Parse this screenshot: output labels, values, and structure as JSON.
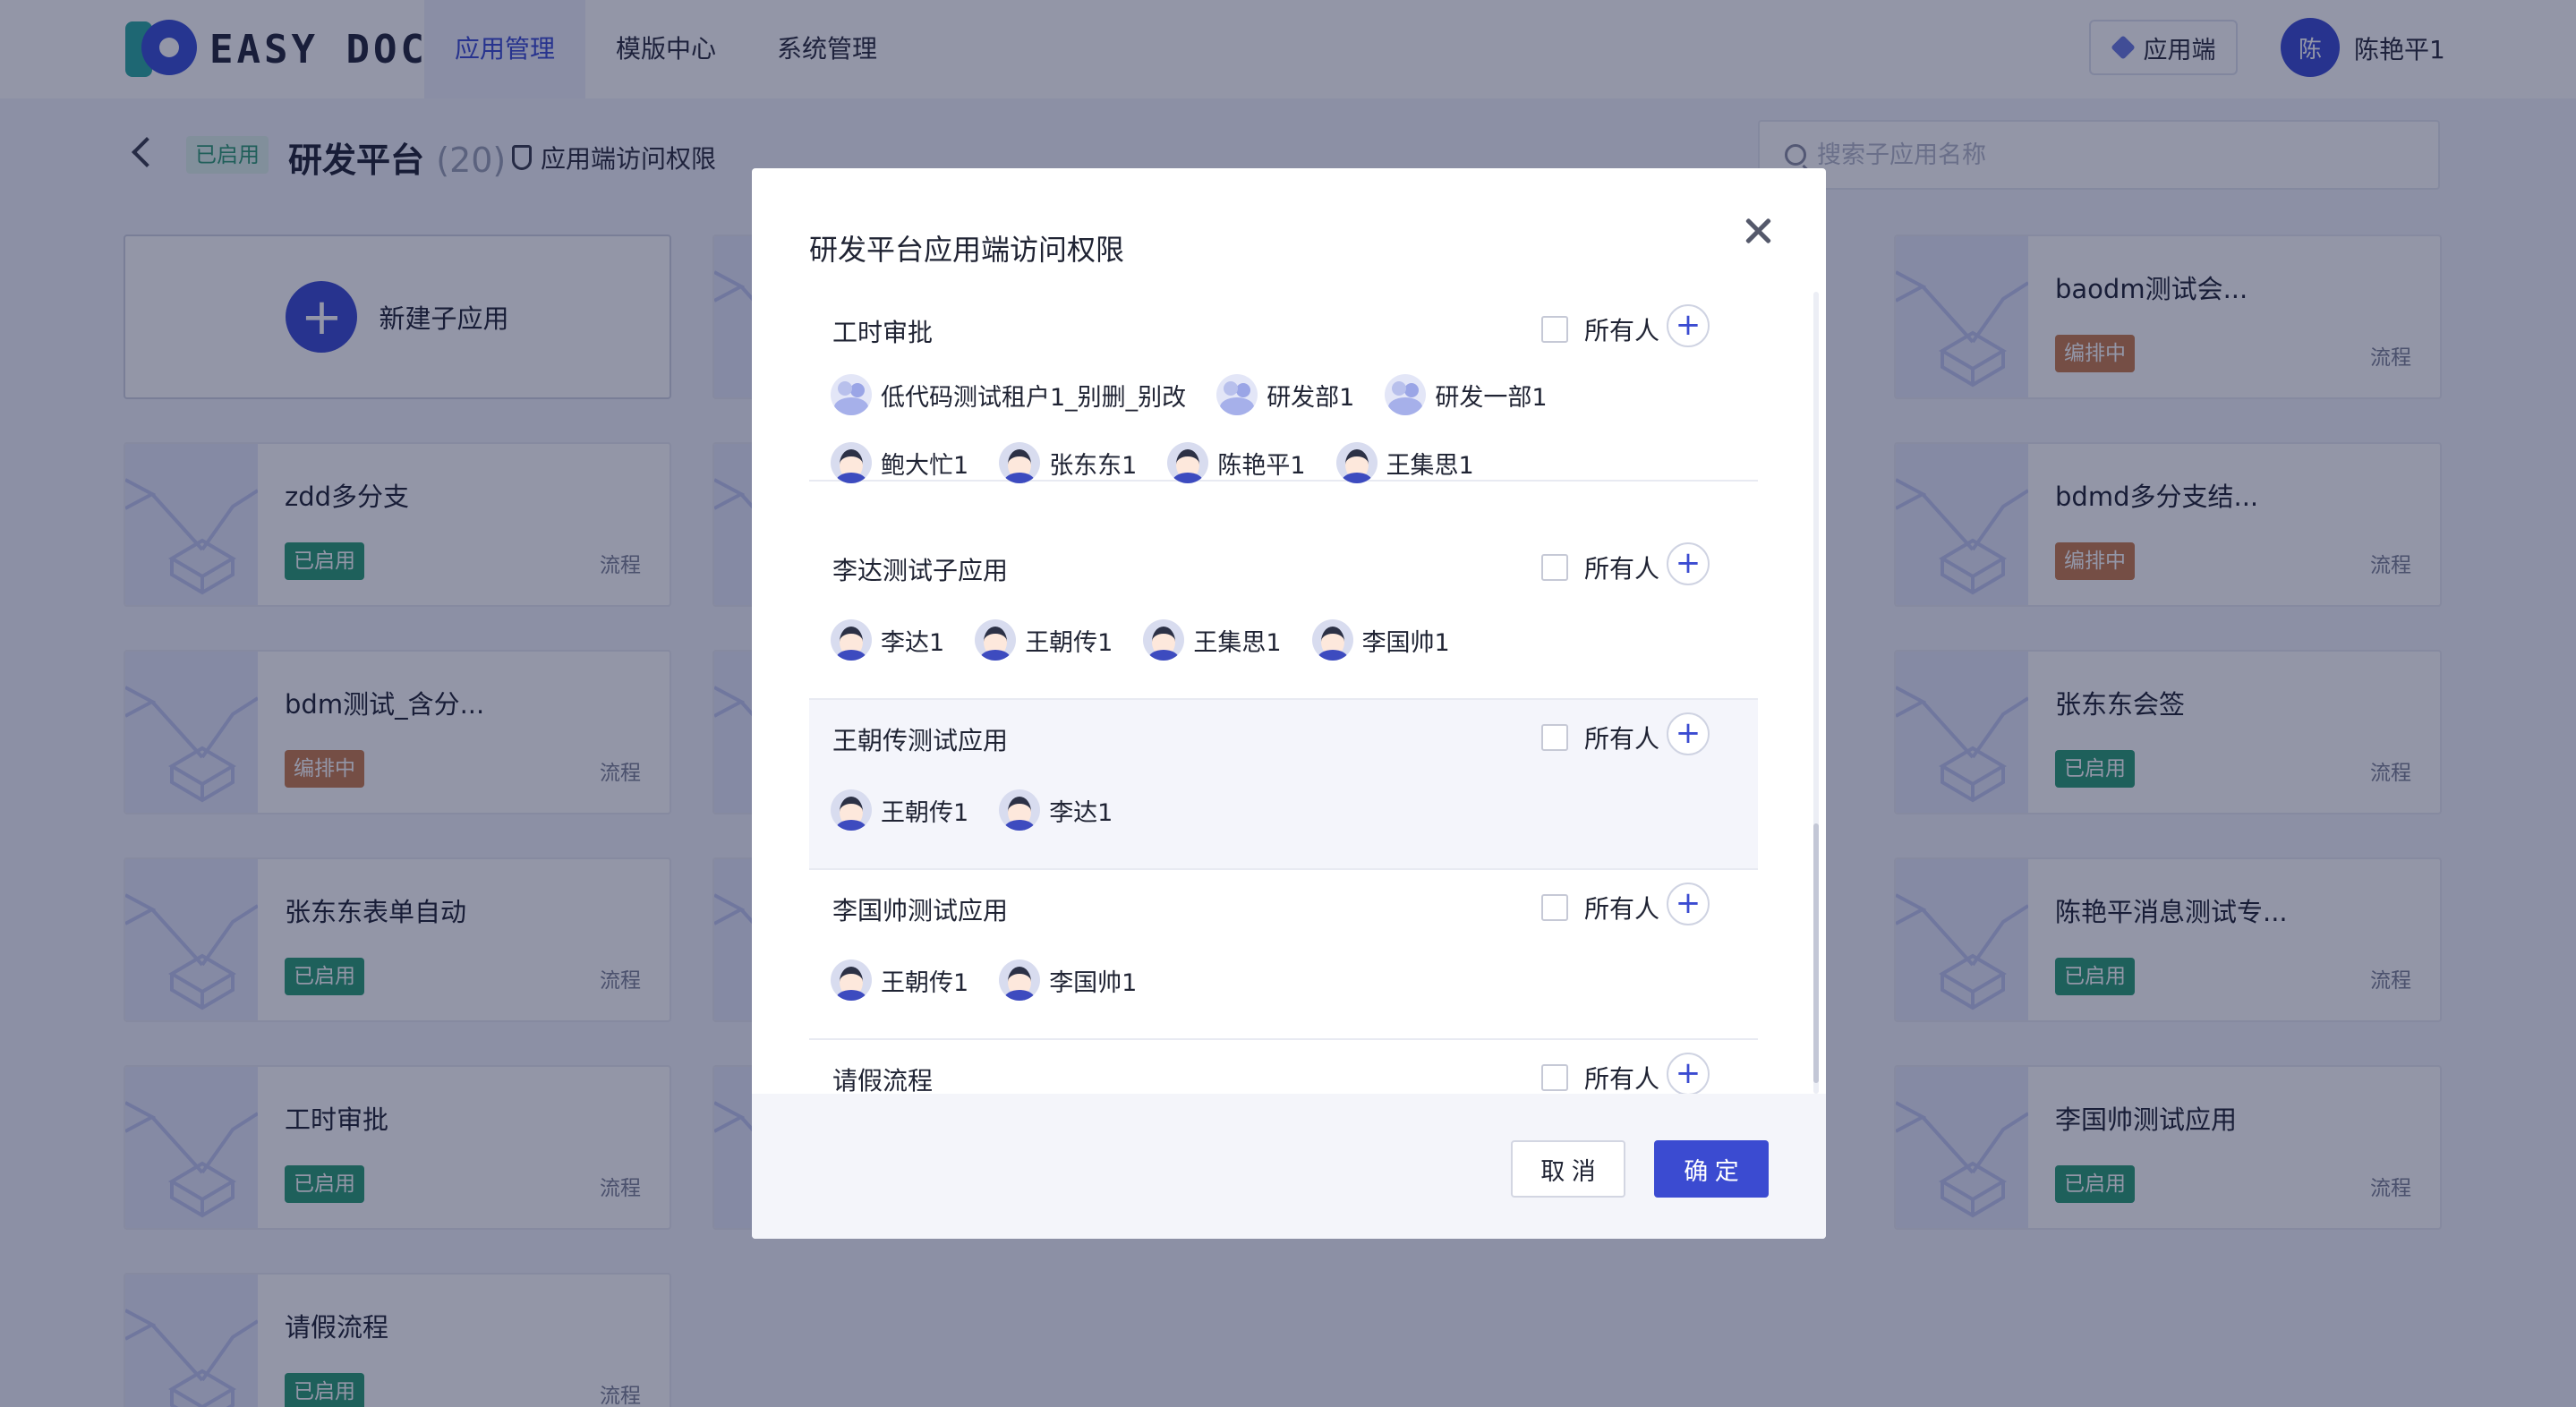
{
  "header": {
    "logo_text": "EASY DOCK",
    "nav": [
      {
        "label": "应用管理",
        "active": true
      },
      {
        "label": "模版中心",
        "active": false
      },
      {
        "label": "系统管理",
        "active": false
      }
    ],
    "app_button": "应用端",
    "user_avatar": "陈",
    "user_name": "陈艳平1"
  },
  "subheader": {
    "status": "已启用",
    "title": "研发平台",
    "count": "(20)",
    "access_link": "应用端访问权限",
    "search_placeholder": "搜索子应用名称"
  },
  "new_card_label": "新建子应用",
  "cards_left": [
    {
      "name": "zdd多分支",
      "status": "已启用",
      "type": "流程"
    },
    {
      "name": "bdm测试_含分...",
      "status": "编排中",
      "type": "流程"
    },
    {
      "name": "张东东表单自动",
      "status": "已启用",
      "type": "流程"
    },
    {
      "name": "工时审批",
      "status": "已启用",
      "type": "流程"
    },
    {
      "name": "请假流程",
      "status": "已启用",
      "type": "流程"
    }
  ],
  "cards_right": [
    {
      "name": "baodm测试会...",
      "status": "编排中",
      "type": "流程"
    },
    {
      "name": "bdmd多分支结...",
      "status": "编排中",
      "type": "流程"
    },
    {
      "name": "张东东会签",
      "status": "已启用",
      "type": "流程"
    },
    {
      "name": "陈艳平消息测试专...",
      "status": "已启用",
      "type": "流程"
    },
    {
      "name": "李国帅测试应用",
      "status": "已启用",
      "type": "流程"
    }
  ],
  "modal": {
    "title": "研发平台应用端访问权限",
    "all_label": "所有人",
    "permissions": [
      {
        "name": "工时审批",
        "groups": [
          "低代码测试租户1_别删_别改",
          "研发部1",
          "研发一部1"
        ],
        "members": [
          "鲍大忙1",
          "张东东1",
          "陈艳平1",
          "王集思1"
        ]
      },
      {
        "name": "李达测试子应用",
        "groups": [],
        "members": [
          "李达1",
          "王朝传1",
          "王集思1",
          "李国帅1"
        ]
      },
      {
        "name": "王朝传测试应用",
        "groups": [],
        "members": [
          "王朝传1",
          "李达1"
        ]
      },
      {
        "name": "李国帅测试应用",
        "groups": [],
        "members": [
          "王朝传1",
          "李国帅1"
        ]
      },
      {
        "name": "请假流程",
        "groups": [],
        "members": []
      }
    ],
    "cancel_label": "取 消",
    "ok_label": "确 定"
  }
}
